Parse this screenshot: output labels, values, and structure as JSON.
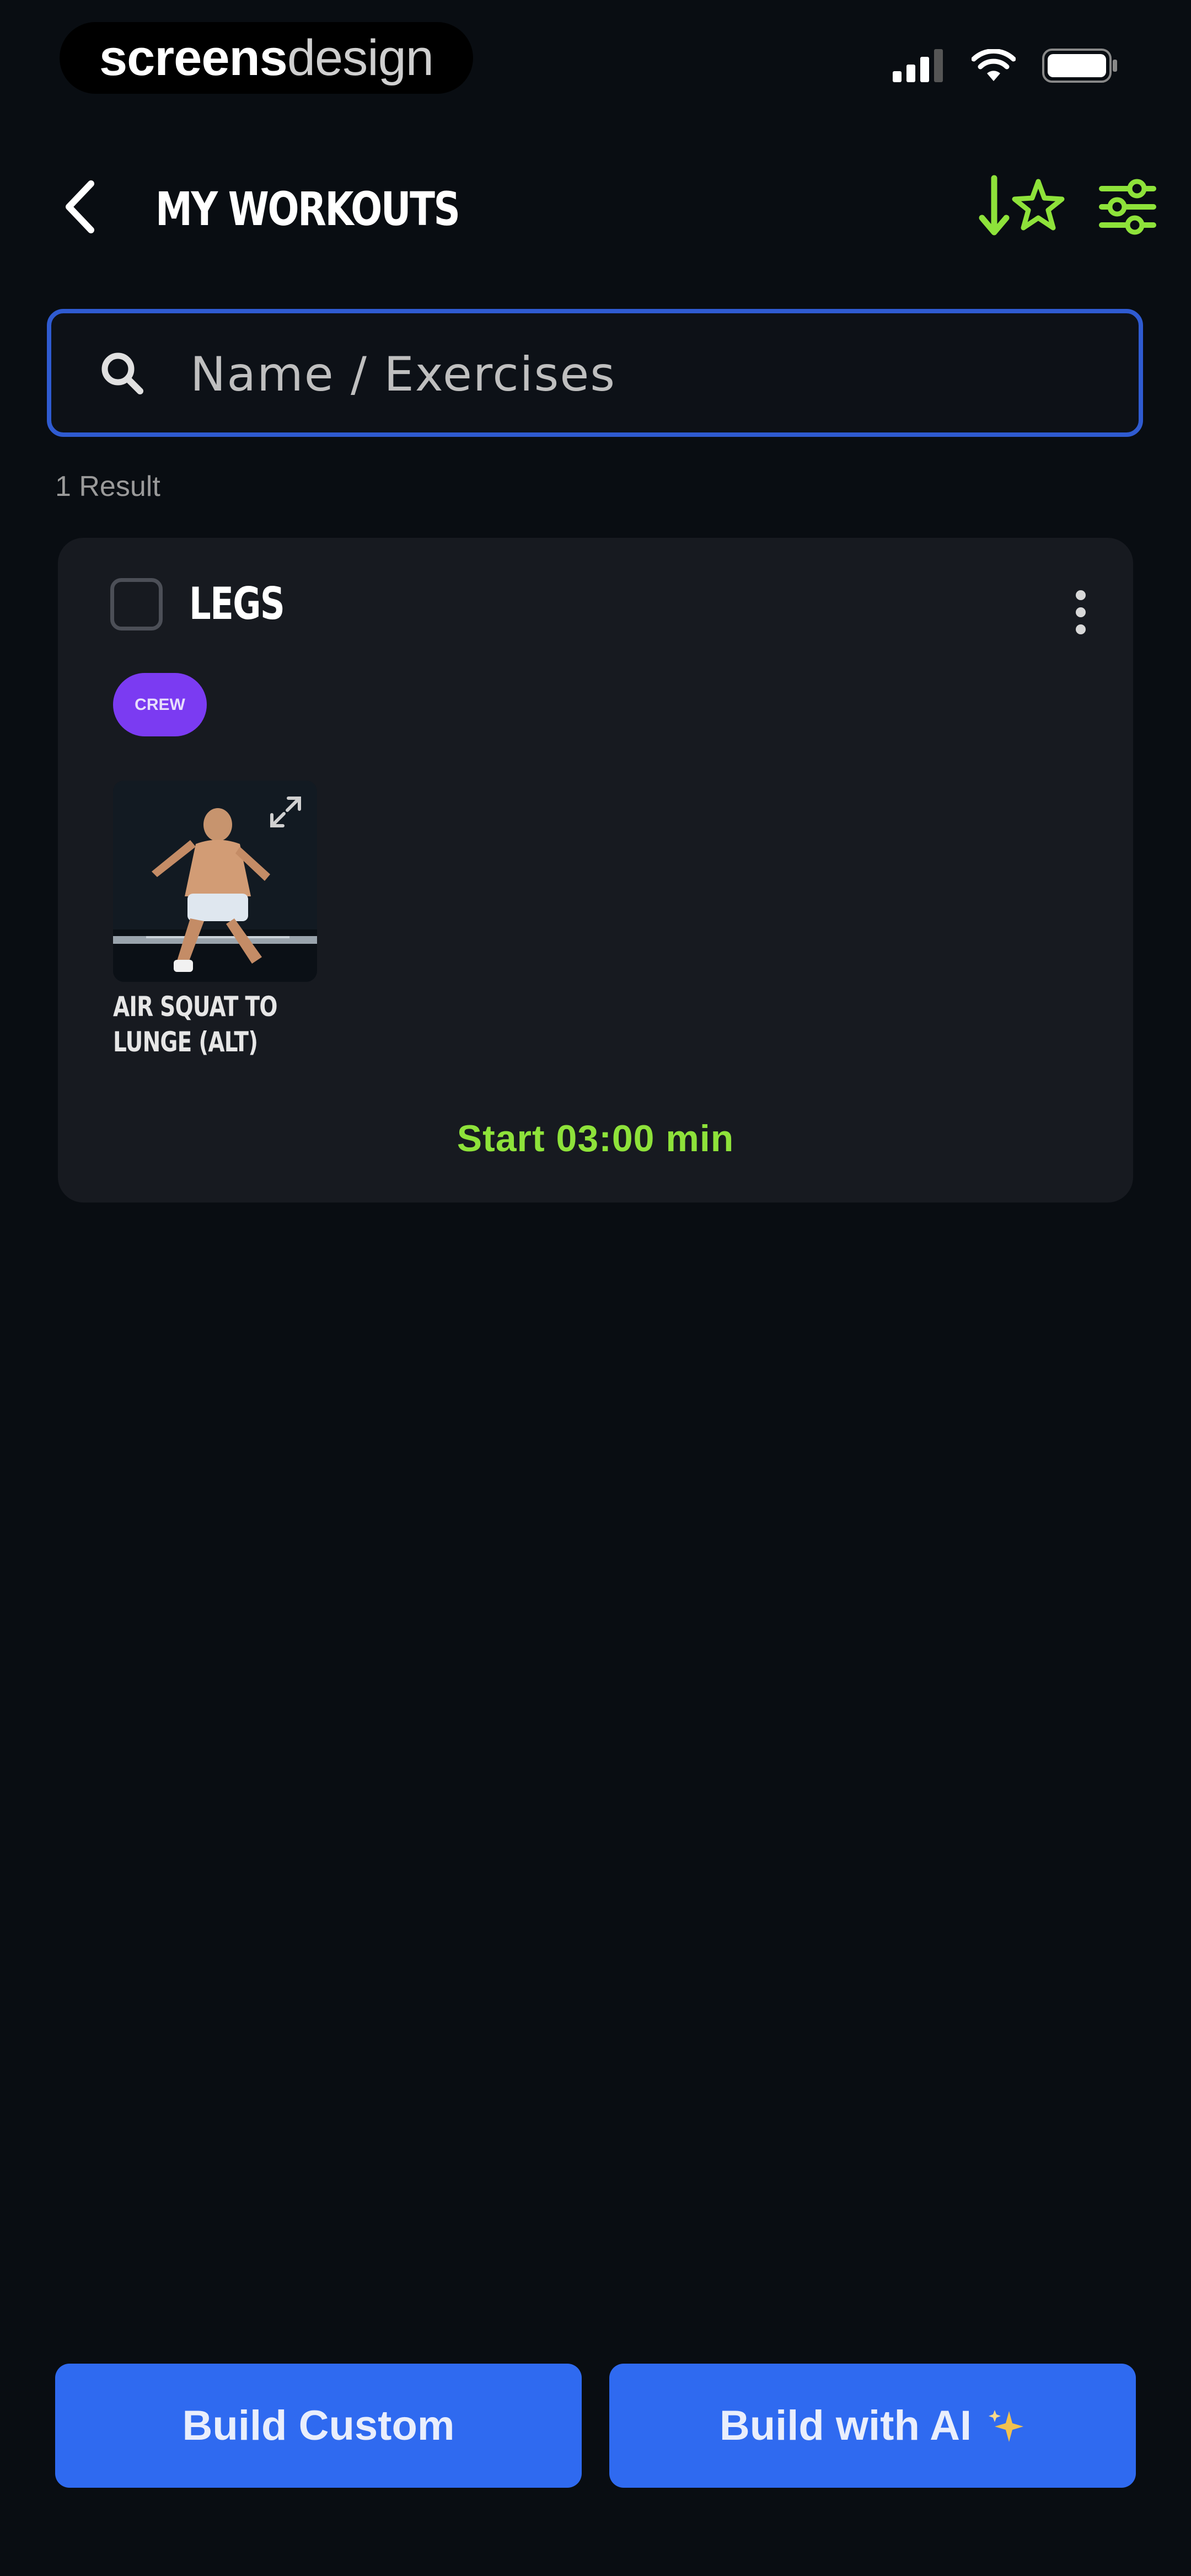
{
  "status_bar": {
    "brand_bold": "screens",
    "brand_light": "design"
  },
  "header": {
    "title": "MY WORKOUTS"
  },
  "search": {
    "placeholder": "Name / Exercises",
    "value": ""
  },
  "results": {
    "count_label": "1 Result"
  },
  "workouts": [
    {
      "title": "LEGS",
      "tag": "CREW",
      "exercises": [
        {
          "name": "AIR SQUAT TO LUNGE (ALT)"
        }
      ],
      "start_label": "Start 03:00 min"
    }
  ],
  "footer": {
    "build_custom_label": "Build Custom",
    "build_ai_label": "Build with AI"
  },
  "colors": {
    "background": "#090d12",
    "card": "#171a20",
    "accent_green": "#8ee23a",
    "primary_blue": "#2f6af0",
    "search_border": "#2f5bd1",
    "tag_purple": "#7b3bf2"
  },
  "icons": [
    "back-arrow-icon",
    "sort-favorites-icon",
    "filter-sliders-icon",
    "search-icon",
    "more-vertical-icon",
    "expand-icon",
    "sparkle-icon",
    "signal-icon",
    "wifi-icon",
    "battery-icon"
  ]
}
